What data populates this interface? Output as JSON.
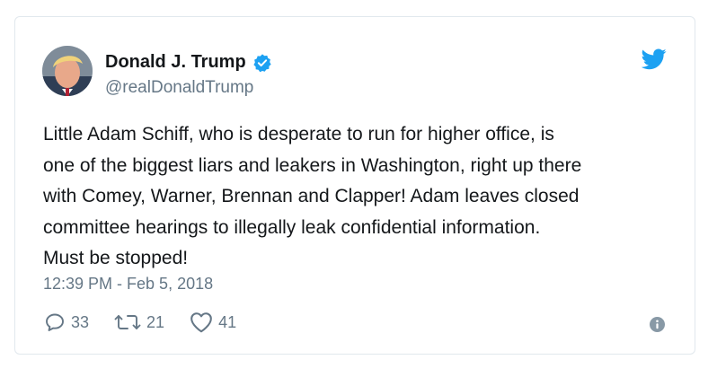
{
  "tweet": {
    "name": "Donald J. Trump",
    "handle": "@realDonaldTrump",
    "text_lines": [
      "Little Adam Schiff, who is desperate to run for higher office, is",
      "one of the biggest liars and leakers in Washington, right up there",
      "with Comey, Warner, Brennan and Clapper! Adam leaves closed",
      "committee hearings to illegally leak confidential information.",
      "Must be stopped!"
    ],
    "timestamp": "12:39 PM - Feb 5, 2018",
    "replies": "33",
    "retweets": "21",
    "likes": "41"
  },
  "icons": {
    "verified": "verified-badge-icon",
    "brand": "twitter-bird-icon",
    "reply": "reply-icon",
    "retweet": "retweet-icon",
    "like": "heart-icon",
    "info": "info-icon"
  },
  "colors": {
    "brand": "#1da1f2",
    "text": "#14171a",
    "secondary": "#657786",
    "border": "#e1e8ed"
  }
}
